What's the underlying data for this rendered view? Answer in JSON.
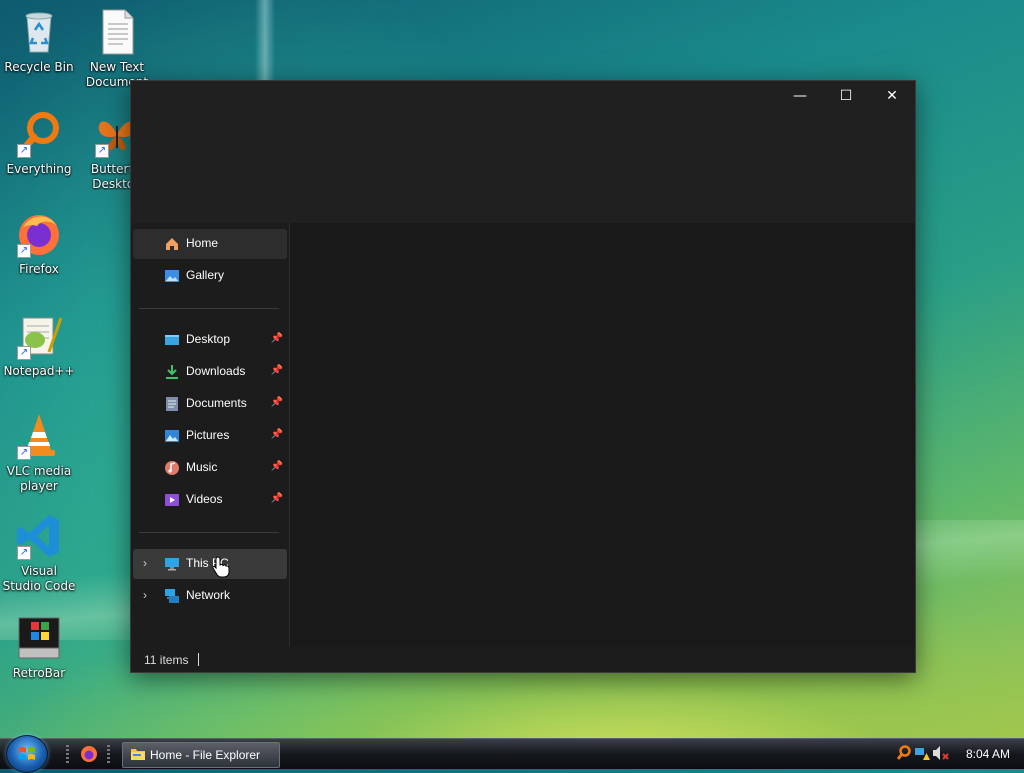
{
  "desktop": {
    "icons": [
      {
        "label": "Recycle Bin"
      },
      {
        "label": "New Text Document"
      },
      {
        "label": "Everything"
      },
      {
        "label": "Butterfly Desktop"
      },
      {
        "label": "Firefox"
      },
      {
        "label": "Notepad++"
      },
      {
        "label": "VLC media player"
      },
      {
        "label": "Visual Studio Code"
      },
      {
        "label": "RetroBar"
      }
    ]
  },
  "explorer": {
    "window_controls": {
      "minimize": "—",
      "maximize": "☐",
      "close": "✕"
    },
    "nav": {
      "home": "Home",
      "gallery": "Gallery",
      "quick_access": [
        {
          "label": "Desktop",
          "icon": "desktop-icon",
          "pinned": true
        },
        {
          "label": "Downloads",
          "icon": "download-icon",
          "pinned": true
        },
        {
          "label": "Documents",
          "icon": "document-icon",
          "pinned": true
        },
        {
          "label": "Pictures",
          "icon": "pictures-icon",
          "pinned": true
        },
        {
          "label": "Music",
          "icon": "music-icon",
          "pinned": true
        },
        {
          "label": "Videos",
          "icon": "videos-icon",
          "pinned": true
        }
      ],
      "this_pc": "This PC",
      "network": "Network"
    },
    "status": {
      "items": "11 items"
    }
  },
  "taskbar": {
    "window_button": "Home - File Explorer",
    "clock": "8:04 AM"
  },
  "colors": {
    "window_bg": "#1c1c1c",
    "selected_nav": "#2d2d2d"
  }
}
